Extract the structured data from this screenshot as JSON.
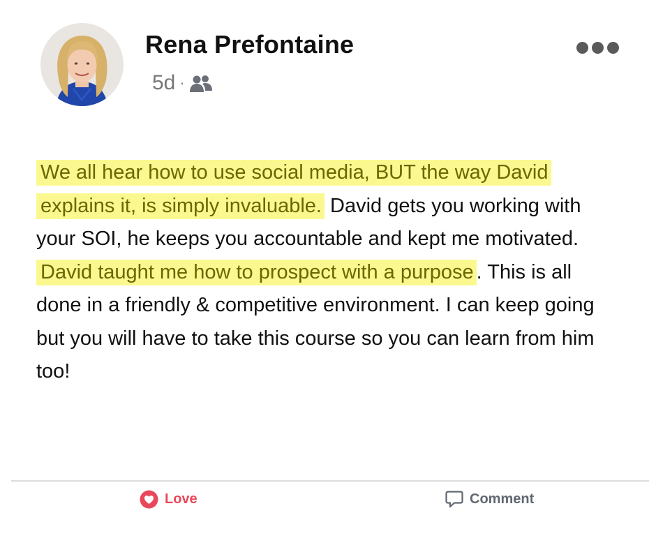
{
  "post": {
    "author": "Rena Prefontaine",
    "time": "5d",
    "separator": "·",
    "audience_icon": "friends-icon",
    "menu_icon": "more-options-icon",
    "segments": [
      {
        "text": "We all hear how to use social media, BUT the way David explains it, is simply invaluable.",
        "highlight": true
      },
      {
        "text": " David gets you working with your SOI, he keeps you accountable and kept me motivated.",
        "highlight": false
      },
      {
        "text": "David taught me how to prospect with a purpose",
        "highlight": true
      },
      {
        "text": ". This is all done in a friendly & competitive environment. I can keep going but you will have to take this course so you can learn from him too!",
        "highlight": false
      }
    ]
  },
  "actions": {
    "love_label": "Love",
    "love_icon": "heart-icon",
    "comment_label": "Comment",
    "comment_icon": "comment-icon"
  },
  "colors": {
    "highlight_bg": "#fbf890",
    "highlight_text": "#6b6700",
    "love": "#e8485a",
    "muted": "#606770"
  }
}
